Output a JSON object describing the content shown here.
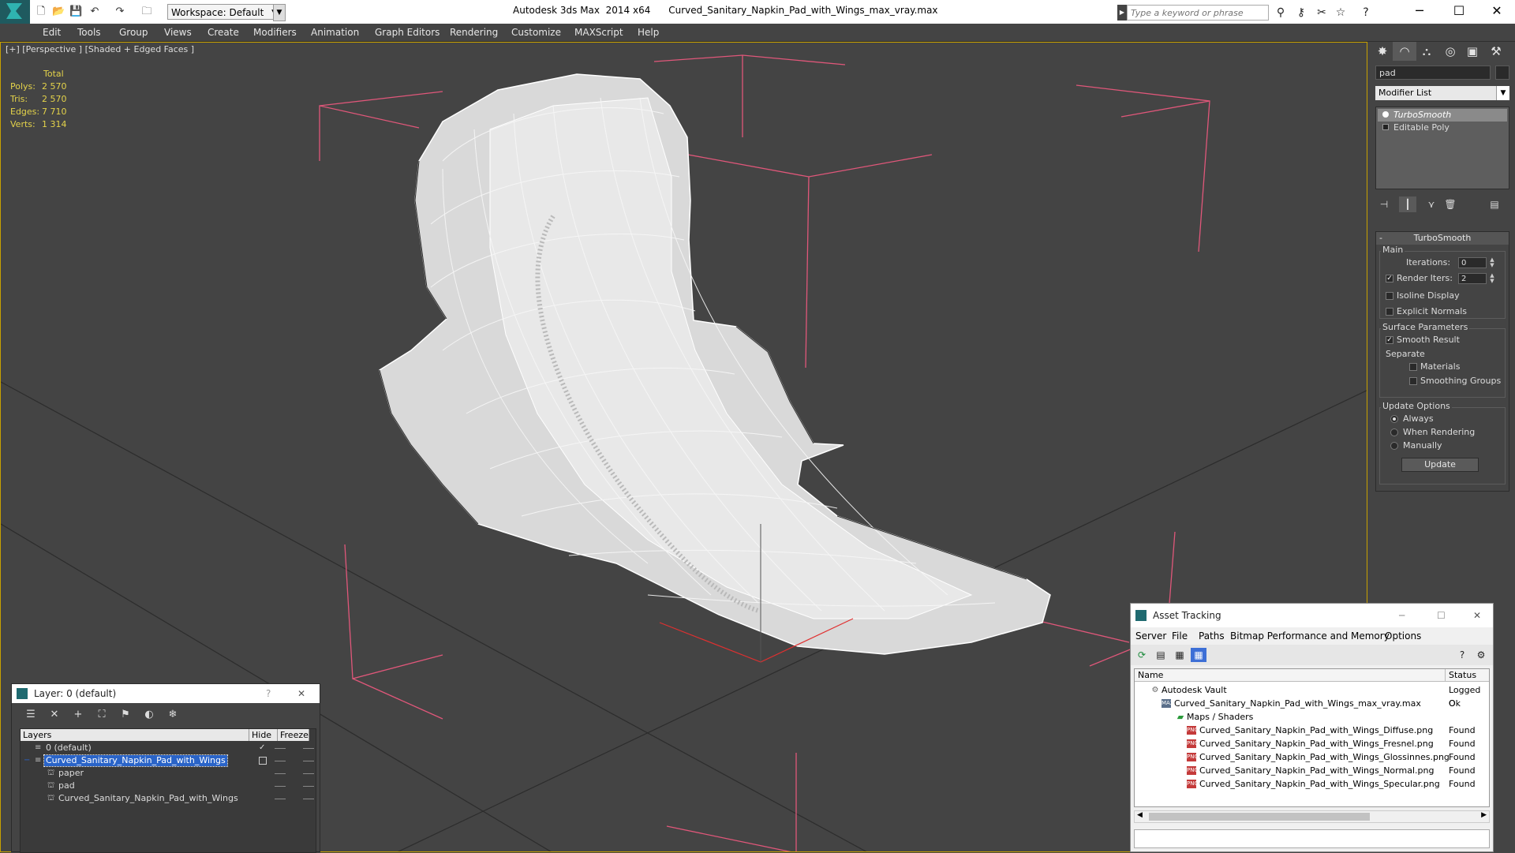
{
  "app": {
    "title": "Autodesk 3ds Max  2014 x64      Curved_Sanitary_Napkin_Pad_with_Wings_max_vray.max",
    "workspace": "Workspace: Default",
    "search_placeholder": "Type a keyword or phrase",
    "window_controls": [
      "─",
      "☐",
      "✕"
    ]
  },
  "menu": [
    "Edit",
    "Tools",
    "Group",
    "Views",
    "Create",
    "Modifiers",
    "Animation",
    "Graph Editors",
    "Rendering",
    "Customize",
    "MAXScript",
    "Help"
  ],
  "viewport": {
    "label": "[+] [Perspective ] [Shaded + Edged Faces ]",
    "stats": {
      "header": "Total",
      "rows": [
        {
          "k": "Polys:",
          "v": "2 570"
        },
        {
          "k": "Tris:",
          "v": "2 570"
        },
        {
          "k": "Edges:",
          "v": "7 710"
        },
        {
          "k": "Verts:",
          "v": "1 314"
        }
      ]
    }
  },
  "command_panel": {
    "object_name": "pad",
    "modifier_list": "Modifier List",
    "stack": [
      "TurboSmooth",
      "Editable Poly"
    ],
    "rollout_title": "TurboSmooth",
    "main": {
      "group": "Main",
      "iterations_label": "Iterations:",
      "iterations": "0",
      "render_iters_label": "Render Iters:",
      "render_iters": "2",
      "isoline": "Isoline Display",
      "explicit": "Explicit Normals"
    },
    "surface": {
      "group": "Surface Parameters",
      "smooth": "Smooth Result",
      "separate": "Separate",
      "materials": "Materials",
      "smoothing": "Smoothing Groups"
    },
    "update": {
      "group": "Update Options",
      "always": "Always",
      "when_rendering": "When Rendering",
      "manually": "Manually",
      "button": "Update"
    }
  },
  "layer_dialog": {
    "title": "Layer: 0 (default)",
    "help": "?",
    "close": "✕",
    "columns": [
      "Layers",
      "Hide",
      "Freeze"
    ],
    "rows": [
      {
        "name": "0 (default)"
      },
      {
        "name": "Curved_Sanitary_Napkin_Pad_with_Wings"
      },
      {
        "name": "paper"
      },
      {
        "name": "pad"
      },
      {
        "name": "Curved_Sanitary_Napkin_Pad_with_Wings"
      }
    ]
  },
  "asset_dialog": {
    "title": "Asset Tracking",
    "menu": [
      "Server",
      "File",
      "Paths",
      "Bitmap Performance and Memory",
      "Options"
    ],
    "columns": [
      "Name",
      "Status"
    ],
    "rows": [
      {
        "name": "Autodesk Vault",
        "status": "Logged O"
      },
      {
        "name": "Curved_Sanitary_Napkin_Pad_with_Wings_max_vray.max",
        "status": "Ok"
      },
      {
        "name": "Maps / Shaders",
        "status": ""
      },
      {
        "name": "Curved_Sanitary_Napkin_Pad_with_Wings_Diffuse.png",
        "status": "Found"
      },
      {
        "name": "Curved_Sanitary_Napkin_Pad_with_Wings_Fresnel.png",
        "status": "Found"
      },
      {
        "name": "Curved_Sanitary_Napkin_Pad_with_Wings_Glossinnes.png",
        "status": "Found"
      },
      {
        "name": "Curved_Sanitary_Napkin_Pad_with_Wings_Normal.png",
        "status": "Found"
      },
      {
        "name": "Curved_Sanitary_Napkin_Pad_with_Wings_Specular.png",
        "status": "Found"
      }
    ],
    "icon_png": "PNG",
    "icon_max": "MAX"
  },
  "colors": {
    "viewport_bg": "#444444",
    "viewport_border": "#c8a100",
    "stats_text": "#e3d24a",
    "selection": "#2a64c8",
    "bounding_box": "#e0577a"
  }
}
